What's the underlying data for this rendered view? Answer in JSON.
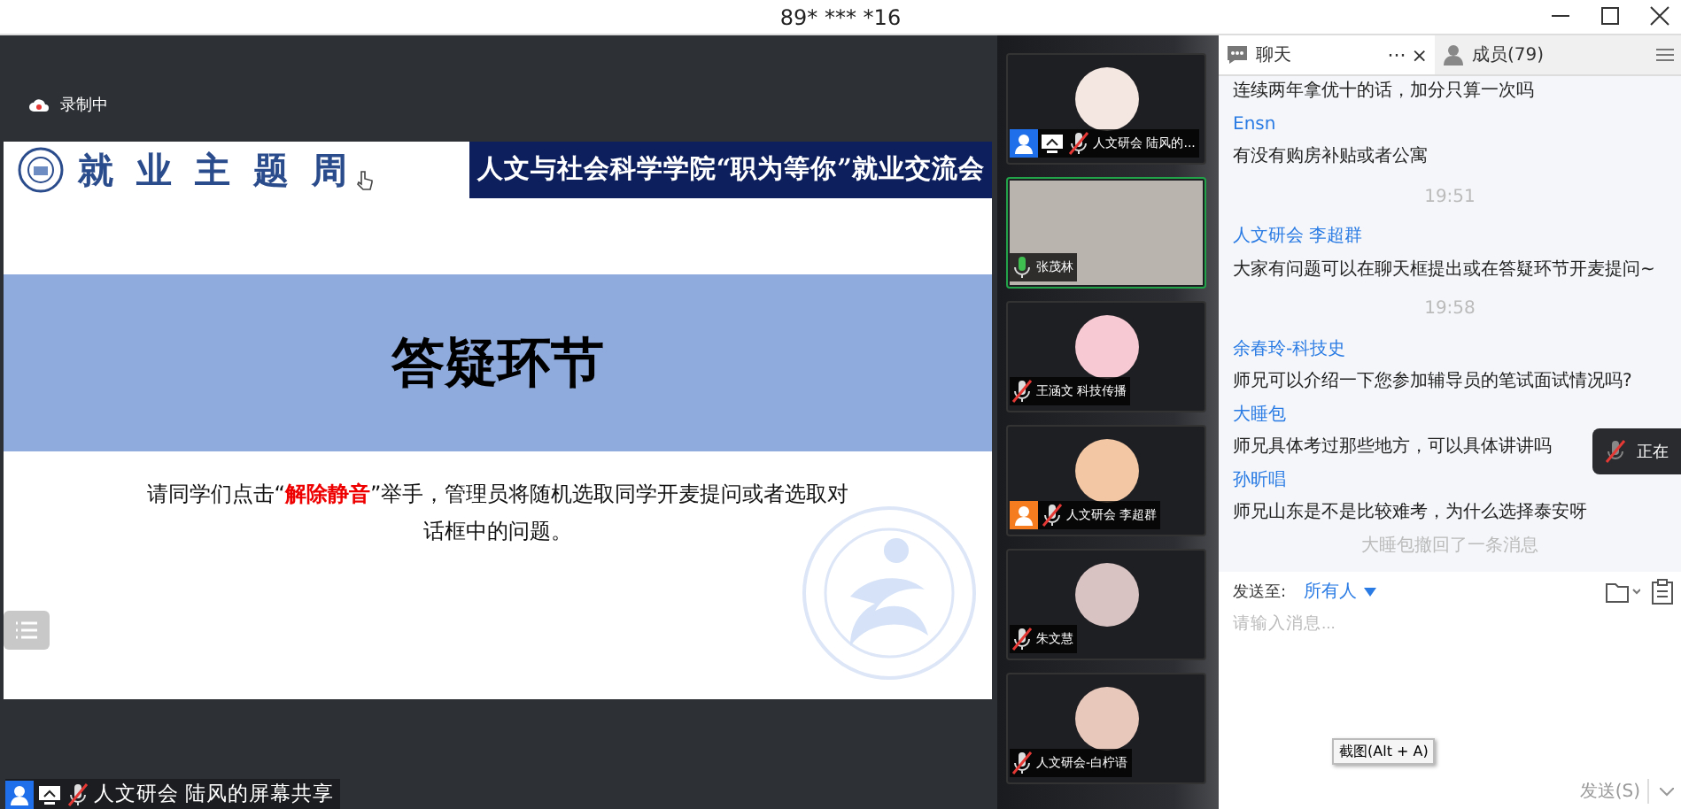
{
  "window": {
    "title": "89* *** *16"
  },
  "recording": {
    "label": "录制中"
  },
  "slide": {
    "brand": "就 业 主 题 周",
    "banner": "人文与社会科学学院“职为等你”就业交流会",
    "title": "答疑环节",
    "body": [
      {
        "text": "请同学们点击“",
        "highlight": false
      },
      {
        "text": "解除静音",
        "highlight": true
      },
      {
        "text": "”举手，管理员将随机选取同学开麦提问或者选取对话框中的问题。",
        "highlight": false
      }
    ]
  },
  "share_label": {
    "name": "人文研会 陆风的屏幕共享",
    "host": true,
    "cohost": false,
    "sharing": true,
    "muted": true
  },
  "participants": [
    {
      "name": "人文研会 陆风的...",
      "kind": "avatar",
      "color": "#f4e6e0",
      "host": true,
      "cohost": false,
      "sharing": true,
      "muted": true,
      "selected": false
    },
    {
      "name": "张茂林",
      "kind": "video",
      "color": "#b9b4ae",
      "host": false,
      "cohost": false,
      "sharing": false,
      "muted": false,
      "selected": true
    },
    {
      "name": "王涵文 科技传播",
      "kind": "avatar",
      "color": "#f6c9d3",
      "host": false,
      "cohost": false,
      "sharing": false,
      "muted": true,
      "selected": false
    },
    {
      "name": "人文研会 李超群",
      "kind": "avatar",
      "color": "#f3c7a4",
      "host": false,
      "cohost": true,
      "sharing": false,
      "muted": true,
      "selected": false
    },
    {
      "name": "朱文慧",
      "kind": "avatar",
      "color": "#d9c2c2",
      "host": false,
      "cohost": false,
      "sharing": false,
      "muted": true,
      "selected": false
    },
    {
      "name": "人文研会-白柠语",
      "kind": "avatar",
      "color": "#e9c8bc",
      "host": false,
      "cohost": false,
      "sharing": false,
      "muted": true,
      "selected": false
    }
  ],
  "chat": {
    "tabs": [
      {
        "label": "聊天",
        "kind": "chat",
        "selected": true
      },
      {
        "label": "成员(79)",
        "kind": "members",
        "selected": false
      }
    ],
    "more": "···",
    "close": "×",
    "messages": [
      {
        "kind": "text",
        "text": "连续两年拿优十的话，加分只算一次吗"
      },
      {
        "kind": "sender",
        "text": "Ensn"
      },
      {
        "kind": "text",
        "text": "有没有购房补贴或者公寓"
      },
      {
        "kind": "time",
        "text": "19:51"
      },
      {
        "kind": "sender",
        "text": "人文研会 李超群"
      },
      {
        "kind": "text",
        "text": "大家有问题可以在聊天框提出或在答疑环节开麦提问~"
      },
      {
        "kind": "time",
        "text": "19:58"
      },
      {
        "kind": "sender",
        "text": "余春玲-科技史"
      },
      {
        "kind": "text",
        "text": "师兄可以介绍一下您参加辅导员的笔试面试情况吗?"
      },
      {
        "kind": "sender",
        "text": "大睡包"
      },
      {
        "kind": "text",
        "text": "师兄具体考过那些地方，可以具体讲讲吗"
      },
      {
        "kind": "sender",
        "text": "孙昕唱"
      },
      {
        "kind": "text",
        "text": "师兄山东是不是比较难考，为什么选择泰安呀"
      },
      {
        "kind": "notice",
        "text": "大睡包撤回了一条消息"
      }
    ],
    "send_to": "发送至:",
    "recipient": "所有人",
    "placeholder": "请输入消息...",
    "send": "发送(S)",
    "tooltip": "截图(Alt + A)"
  },
  "toast": {
    "text": "正在"
  }
}
